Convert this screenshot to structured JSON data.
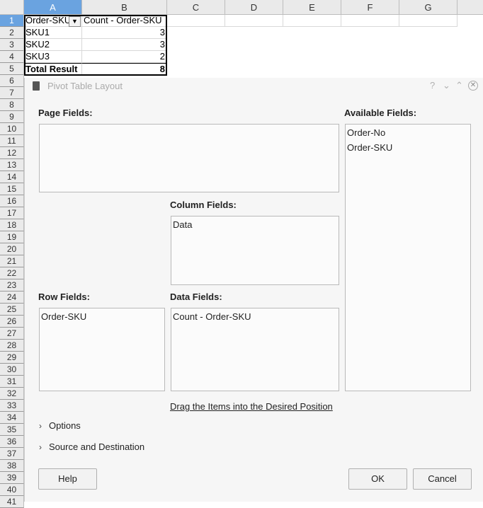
{
  "spreadsheet": {
    "columns": [
      "A",
      "B",
      "C",
      "D",
      "E",
      "F",
      "G"
    ],
    "rows": [
      "1",
      "2",
      "3",
      "4",
      "5",
      "6",
      "7",
      "8",
      "9",
      "10",
      "11",
      "12",
      "13",
      "14",
      "15",
      "16",
      "17",
      "18",
      "19",
      "20",
      "21",
      "22",
      "23",
      "24",
      "25",
      "26",
      "27",
      "28",
      "29",
      "30",
      "31",
      "32",
      "33",
      "34",
      "35",
      "36",
      "37",
      "38",
      "39",
      "40",
      "41"
    ],
    "cells": {
      "a1": "Order-SKU",
      "b1": "Count - Order-SKU",
      "a2": "SKU1",
      "b2": "3",
      "a3": "SKU2",
      "b3": "3",
      "a4": "SKU3",
      "b4": "2",
      "a5": "Total Result",
      "b5": "8"
    }
  },
  "dialog": {
    "title": "Pivot Table Layout",
    "help_glyph": "?",
    "page_fields_label": "Page Fields:",
    "available_fields_label": "Available Fields:",
    "available_fields": [
      "Order-No",
      "Order-SKU"
    ],
    "column_fields_label": "Column Fields:",
    "column_fields": [
      "Data"
    ],
    "row_fields_label": "Row Fields:",
    "row_fields": [
      "Order-SKU"
    ],
    "data_fields_label": "Data Fields:",
    "data_fields": [
      "Count - Order-SKU"
    ],
    "hint": "Drag the Items into the Desired Position",
    "options_label": "Options",
    "source_label": "Source and Destination",
    "help_button": "Help",
    "ok_button": "OK",
    "cancel_button": "Cancel"
  }
}
